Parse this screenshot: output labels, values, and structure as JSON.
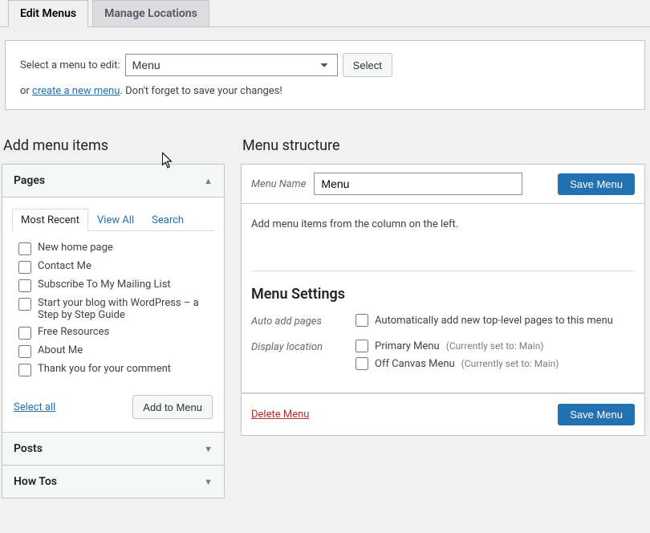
{
  "tabs": {
    "edit": "Edit Menus",
    "manage": "Manage Locations"
  },
  "selector": {
    "label": "Select a menu to edit:",
    "selected": "Menu",
    "button": "Select",
    "or": "or ",
    "create_link": "create a new menu",
    "hint_tail": ". Don't forget to save your changes!"
  },
  "left": {
    "heading": "Add menu items",
    "pages_title": "Pages",
    "inner_tabs": {
      "recent": "Most Recent",
      "all": "View All",
      "search": "Search"
    },
    "pages": [
      "New home page",
      "Contact Me",
      "Subscribe To My Mailing List",
      "Start your blog with WordPress – a Step by Step Guide",
      "Free Resources",
      "About Me",
      "Thank you for your comment"
    ],
    "select_all": "Select all",
    "add_btn": "Add to Menu",
    "posts_title": "Posts",
    "howtos_title": "How Tos"
  },
  "right": {
    "heading": "Menu structure",
    "menu_name_label": "Menu Name",
    "menu_name_value": "Menu",
    "save_btn": "Save Menu",
    "hint": "Add menu items from the column on the left.",
    "settings_title": "Menu Settings",
    "auto_label": "Auto add pages",
    "auto_check": "Automatically add new top-level pages to this menu",
    "display_label": "Display location",
    "loc1": "Primary Menu",
    "loc1_sub": "(Currently set to: Main)",
    "loc2": "Off Canvas Menu",
    "loc2_sub": "(Currently set to: Main)",
    "delete": "Delete Menu"
  }
}
